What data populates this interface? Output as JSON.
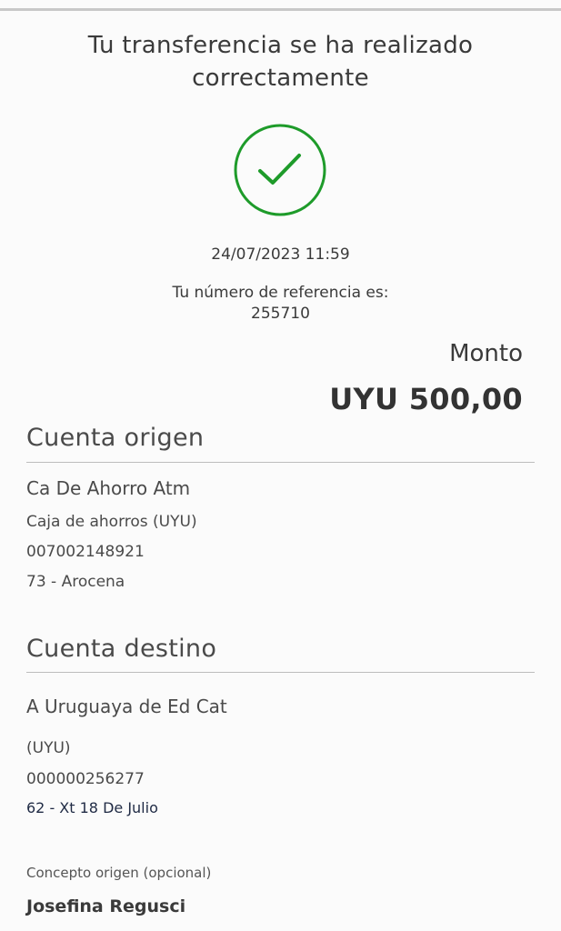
{
  "header": {
    "title_line1": "Tu transferencia se ha realizado",
    "title_line2": "correctamente"
  },
  "status": {
    "icon": "check-circle-icon",
    "color": "#1e9b2a"
  },
  "transaction": {
    "datetime": "24/07/2023 11:59",
    "reference_label": "Tu número de referencia es:",
    "reference_number": "255710",
    "amount_label": "Monto",
    "amount_value": "UYU 500,00"
  },
  "origin": {
    "section_title": "Cuenta origen",
    "account_name": "Ca De Ahorro Atm",
    "account_type": "Caja de ahorros (UYU)",
    "account_number": "007002148921",
    "branch": "73 - Arocena"
  },
  "destination": {
    "section_title": "Cuenta destino",
    "account_name": "A Uruguaya de Ed Cat",
    "account_type": "(UYU)",
    "account_number": "000000256277",
    "branch": "62 - Xt 18 De Julio"
  },
  "concept": {
    "label": "Concepto origen (opcional)",
    "value": "Josefina Regusci"
  }
}
